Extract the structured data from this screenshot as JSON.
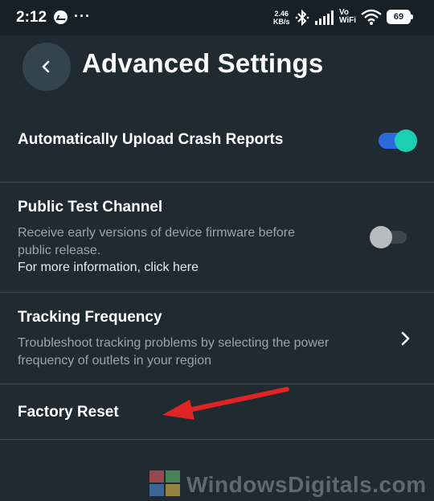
{
  "status_bar": {
    "time": "2:12",
    "dots": "···",
    "net_speed_value": "2.46",
    "net_speed_unit": "KB/s",
    "vo": "Vo",
    "wifi_label": "WiFi",
    "battery": "69",
    "icons": [
      "messenger-icon",
      "bluetooth-icon",
      "signal-icon",
      "wifi-icon",
      "battery-icon"
    ]
  },
  "header": {
    "title": "Advanced Settings"
  },
  "settings": {
    "crash_reports": {
      "label": "Automatically Upload Crash Reports",
      "enabled": true
    },
    "public_test": {
      "label": "Public Test Channel",
      "desc_line1": "Receive early versions of device firmware before",
      "desc_line2": "public release.",
      "link": "For more information, click here",
      "enabled": false
    },
    "tracking": {
      "label": "Tracking Frequency",
      "desc_line1": "Troubleshoot tracking problems by selecting the power",
      "desc_line2": "frequency of outlets in your region"
    },
    "factory_reset": {
      "label": "Factory Reset"
    }
  },
  "colors": {
    "background": "#1f2a31",
    "toggle_on_track": "#2b6ad8",
    "toggle_on_knob": "#1bd0b2",
    "annotation_arrow": "#e02424"
  },
  "watermark": {
    "text": "WindowsDigitals.com"
  }
}
